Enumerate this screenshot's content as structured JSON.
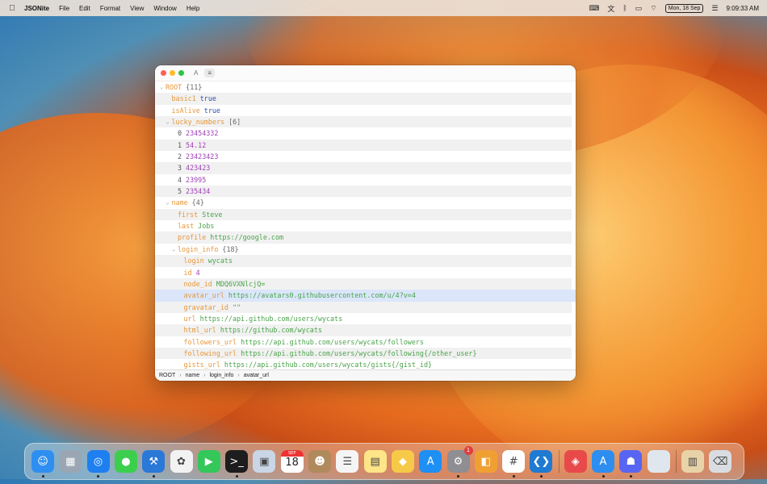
{
  "menubar": {
    "app_name": "JSONite",
    "items": [
      "File",
      "Edit",
      "Format",
      "View",
      "Window",
      "Help"
    ],
    "date": "Mon, 18 Sep",
    "time": "9:09:33 AM"
  },
  "window": {
    "toolbar": {
      "font_button": "A",
      "tree_button": "≡"
    },
    "rows": [
      {
        "depth": 0,
        "chev": "⌄",
        "key": "ROOT",
        "count": "{11}"
      },
      {
        "depth": 1,
        "key": "basic1",
        "value": "true",
        "vtype": "bool"
      },
      {
        "depth": 1,
        "key": "isAlive",
        "value": "true",
        "vtype": "bool"
      },
      {
        "depth": 1,
        "chev": "⌄",
        "key": "lucky_numbers",
        "count": "[6]"
      },
      {
        "depth": 2,
        "idx": "0",
        "value": "23454332",
        "vtype": "num"
      },
      {
        "depth": 2,
        "idx": "1",
        "value": "54.12",
        "vtype": "num"
      },
      {
        "depth": 2,
        "idx": "2",
        "value": "23423423",
        "vtype": "num"
      },
      {
        "depth": 2,
        "idx": "3",
        "value": "423423",
        "vtype": "num"
      },
      {
        "depth": 2,
        "idx": "4",
        "value": "23995",
        "vtype": "num"
      },
      {
        "depth": 2,
        "idx": "5",
        "value": "235434",
        "vtype": "num"
      },
      {
        "depth": 1,
        "chev": "⌄",
        "key": "name",
        "count": "{4}"
      },
      {
        "depth": 2,
        "key": "first",
        "value": "Steve",
        "vtype": "str"
      },
      {
        "depth": 2,
        "key": "last",
        "value": "Jobs",
        "vtype": "str"
      },
      {
        "depth": 2,
        "key": "profile",
        "value": "https://google.com",
        "vtype": "str"
      },
      {
        "depth": 2,
        "chev": "⌄",
        "key": "login_info",
        "count": "{18}"
      },
      {
        "depth": 3,
        "key": "login",
        "value": "wycats",
        "vtype": "str"
      },
      {
        "depth": 3,
        "key": "id",
        "value": "4",
        "vtype": "num"
      },
      {
        "depth": 3,
        "key": "node_id",
        "value": "MDQ6VXNlcjQ=",
        "vtype": "str"
      },
      {
        "depth": 3,
        "key": "avatar_url",
        "value": "https://avatars0.githubusercontent.com/u/4?v=4",
        "vtype": "str",
        "selected": true
      },
      {
        "depth": 3,
        "key": "gravatar_id",
        "value": "\"\"",
        "vtype": "str"
      },
      {
        "depth": 3,
        "key": "url",
        "value": "https://api.github.com/users/wycats",
        "vtype": "str"
      },
      {
        "depth": 3,
        "key": "html_url",
        "value": "https://github.com/wycats",
        "vtype": "str"
      },
      {
        "depth": 3,
        "key": "followers_url",
        "value": "https://api.github.com/users/wycats/followers",
        "vtype": "str"
      },
      {
        "depth": 3,
        "key": "following_url",
        "value": "https://api.github.com/users/wycats/following{/other_user}",
        "vtype": "str"
      },
      {
        "depth": 3,
        "key": "gists_url",
        "value": "https://api.github.com/users/wycats/gists{/gist_id}",
        "vtype": "str"
      }
    ],
    "breadcrumb": [
      "ROOT",
      "name",
      "login_info",
      "avatar_url"
    ]
  },
  "dock": {
    "apps": [
      {
        "name": "finder-icon",
        "glyph": "☺",
        "bg": "#2f8ff0",
        "dot": true
      },
      {
        "name": "launchpad-icon",
        "glyph": "▦",
        "bg": "#9aa6b4",
        "dot": false
      },
      {
        "name": "safari-icon",
        "glyph": "◎",
        "bg": "#1e7ff0",
        "dot": true
      },
      {
        "name": "messages-icon",
        "glyph": "●",
        "bg": "#3ccf4e",
        "dot": false
      },
      {
        "name": "xcode-icon",
        "glyph": "⚒",
        "bg": "#2a78d8",
        "dot": true
      },
      {
        "name": "photos-icon",
        "glyph": "✿",
        "bg": "#f2f2f2",
        "dot": false
      },
      {
        "name": "facetime-icon",
        "glyph": "▶",
        "bg": "#34c759",
        "dot": false
      },
      {
        "name": "terminal-icon",
        "glyph": ">_",
        "bg": "#1d1d1d",
        "dot": true
      },
      {
        "name": "preview-icon",
        "glyph": "▣",
        "bg": "#c9d6e6",
        "dot": false
      },
      {
        "name": "calendar-icon",
        "glyph": "",
        "bg": "#ffffff",
        "dot": false,
        "cal_month": "SEP",
        "cal_day": "18"
      },
      {
        "name": "contacts-icon",
        "glyph": "☻",
        "bg": "#b08a5c",
        "dot": false
      },
      {
        "name": "reminders-icon",
        "glyph": "☰",
        "bg": "#f5f5f5",
        "dot": false
      },
      {
        "name": "notes-icon",
        "glyph": "▤",
        "bg": "#fde588",
        "dot": false
      },
      {
        "name": "sketch-icon",
        "glyph": "◆",
        "bg": "#f7c948",
        "dot": false
      },
      {
        "name": "app-store-icon",
        "glyph": "A",
        "bg": "#1e8ff5",
        "dot": false
      },
      {
        "name": "system-settings-icon",
        "glyph": "⚙",
        "bg": "#8e8e93",
        "dot": true,
        "badge": "1"
      },
      {
        "name": "screens-icon",
        "glyph": "◧",
        "bg": "#f0a033",
        "dot": false
      },
      {
        "name": "slack-icon",
        "glyph": "#",
        "bg": "#ffffff",
        "dot": true
      },
      {
        "name": "vscode-icon",
        "glyph": "❮❯",
        "bg": "#1f7ad1",
        "dot": true
      },
      {
        "name": "git-icon",
        "glyph": "◈",
        "bg": "#e84a4a",
        "dot": false
      },
      {
        "name": "app-store-2-icon",
        "glyph": "A",
        "bg": "#2d8ef0",
        "dot": true
      },
      {
        "name": "discord-icon",
        "glyph": "☗",
        "bg": "#5865f2",
        "dot": true
      },
      {
        "name": "blank-app-icon",
        "glyph": "",
        "bg": "#dfe6ee",
        "dot": false
      },
      {
        "name": "downloads-stack-icon",
        "glyph": "▥",
        "bg": "#e8d3a8",
        "dot": false
      },
      {
        "name": "trash-icon",
        "glyph": "⌫",
        "bg": "#d9dde2",
        "dot": false
      }
    ]
  }
}
